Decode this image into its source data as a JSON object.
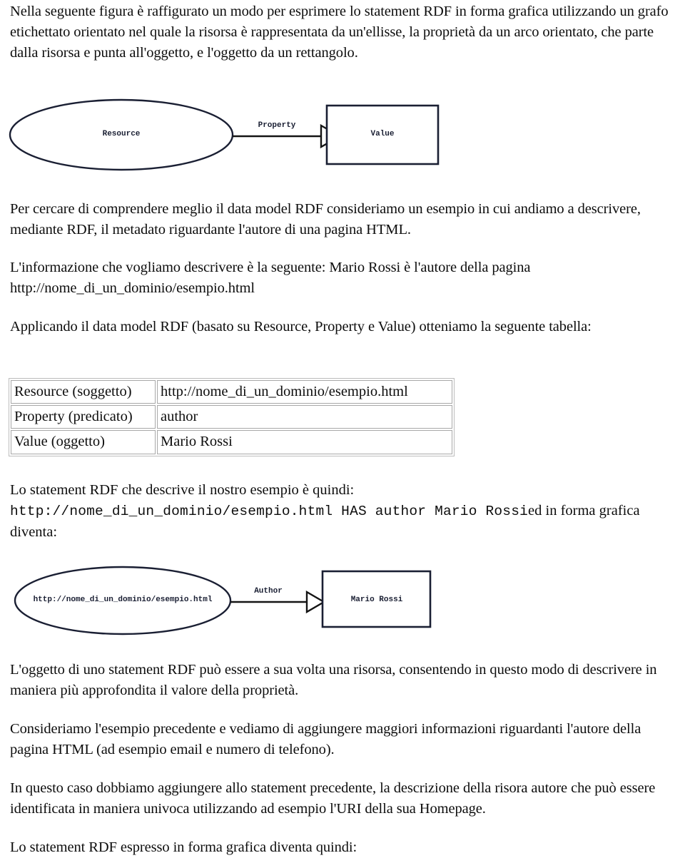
{
  "document": {
    "language": "it",
    "paragraphs": {
      "intro": "Nella seguente figura è raffigurato un modo per esprimere lo statement RDF in forma grafica utilizzando un grafo etichettato orientato nel quale la risorsa è rappresentata da un'ellisse, la proprietà da un arco orientato, che parte dalla risorsa e punta all'oggetto, e l'oggetto da un rettangolo.",
      "p_comprendere": "Per cercare di comprendere meglio il data model RDF consideriamo un esempio in cui andiamo a descrivere, mediante RDF, il metadato riguardante l'autore di una pagina HTML.",
      "p_informazione": "L'informazione che vogliamo descrivere è la seguente: Mario Rossi è l'autore della pagina http://nome_di_un_dominio/esempio.html",
      "p_applicando": "Applicando il data model RDF (basato su Resource, Property e Value) otteniamo la seguente tabella:",
      "p_statement_intro": "Lo statement RDF che descrive il nostro esempio è quindi:",
      "p_statement_tail": "ed in forma grafica diventa:",
      "p_oggetto": "L'oggetto di uno statement RDF può essere a sua volta una risorsa, consentendo in questo modo di descrivere in maniera più approfondita il valore della proprietà.",
      "p_consideriamo": "Consideriamo l'esempio precedente e vediamo di aggiungere maggiori informazioni riguardanti l'autore della pagina HTML (ad esempio email e numero di telefono).",
      "p_inquesto": "In questo caso dobbiamo aggiungere allo statement precedente, la descrizione della risora autore che può essere identificata in maniera univoca utilizzando ad esempio l'URI della sua Homepage.",
      "p_espresso": "Lo statement RDF espresso in forma grafica diventa quindi:"
    },
    "statement_mono": "http://nome_di_un_dominio/esempio.html HAS author Mario Rossi"
  },
  "diagram_generic": {
    "caption": "RDF graph: Resource -- Property --> Value",
    "resource_label": "Resource",
    "property_label": "Property",
    "value_label": "Value",
    "stroke_color": "#1a1f33",
    "fill_color": "#ffffff"
  },
  "diagram_example": {
    "caption": "RDF graph example: http://nome_di_un_dominio/esempio.html -- Author --> Mario Rossi",
    "resource_label": "http://nome_di_un_dominio/esempio.html",
    "property_label": "Author",
    "value_label": "Mario Rossi",
    "stroke_color": "#1a1f33",
    "fill_color": "#ffffff"
  },
  "table": {
    "rows": [
      {
        "label": "Resource (soggetto)",
        "value": "http://nome_di_un_dominio/esempio.html"
      },
      {
        "label": "Property (predicato)",
        "value": "author"
      },
      {
        "label": "Value (oggetto)",
        "value": "Mario Rossi"
      }
    ]
  }
}
